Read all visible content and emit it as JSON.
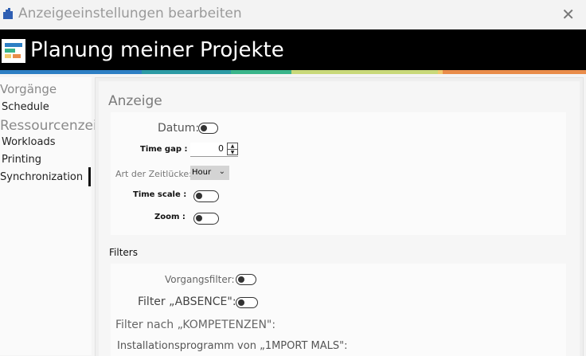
{
  "window": {
    "title": "Anzeigeeinstellungen bearbeiten",
    "close_glyph": "✕"
  },
  "header": {
    "title": "Planung meiner Projekte"
  },
  "colors": {
    "stripe": [
      "#2d7fc4",
      "#2c9aa4",
      "#3ab58a",
      "#c9d97a",
      "#f2c96c",
      "#e98c4a"
    ]
  },
  "sidebar": {
    "items": [
      {
        "label": "Vorgänge",
        "kind": "section"
      },
      {
        "label": "Schedule",
        "kind": "item"
      },
      {
        "label": "Ressourcenzeilen",
        "kind": "section"
      },
      {
        "label": "Workloads",
        "kind": "item"
      },
      {
        "label": "Printing",
        "kind": "item"
      },
      {
        "label": "Synchronization",
        "kind": "item",
        "active": true
      }
    ]
  },
  "anzeige": {
    "heading": "Anzeige",
    "datum_label": "Datum:",
    "time_gap_label": "Time gap :",
    "time_gap_value": "0",
    "art_label": "Art der Zeitlücke:",
    "art_value": "Hour",
    "time_scale_label": "Time scale :",
    "zoom_label": "Zoom :"
  },
  "filters": {
    "heading": "Filters",
    "vorgang_label": "Vorgangsfilter:",
    "absence_label": "Filter „ABSENCE\":",
    "kompetenzen_label": "Filter nach „KOMPETENZEN\":",
    "installation_label": "Installationsprogramm von „1MPORT MALS\":"
  }
}
